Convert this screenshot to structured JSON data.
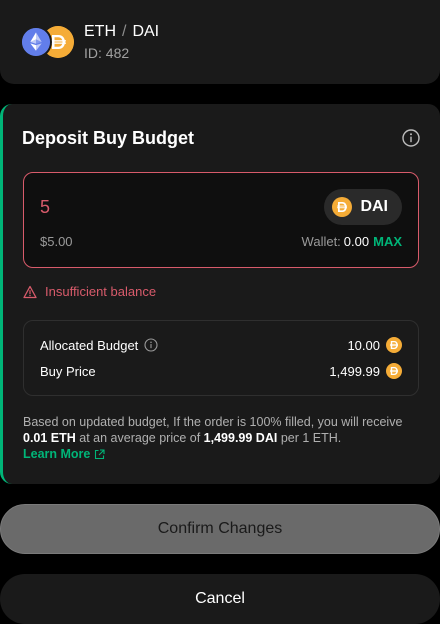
{
  "pair": {
    "base": "ETH",
    "separator": "/",
    "quote": "DAI",
    "id_text": "ID: 482"
  },
  "deposit": {
    "title": "Deposit Buy Budget",
    "amount": "5",
    "usd_value": "$5.00",
    "token": "DAI",
    "wallet_label": "Wallet:",
    "wallet_value": "0.00",
    "max_label": "MAX",
    "error": "Insufficient balance"
  },
  "summary": {
    "allocated_label": "Allocated Budget",
    "allocated_value": "10.00",
    "price_label": "Buy Price",
    "price_value": "1,499.99"
  },
  "footnote": {
    "part1": "Based on updated budget, If the order is 100% filled, you will receive ",
    "receive_amount": "0.01 ETH",
    "part2": " at an average price of ",
    "avg_price": "1,499.99 DAI",
    "part3": " per 1 ETH.",
    "learn_more": "Learn More"
  },
  "actions": {
    "confirm": "Confirm Changes",
    "cancel": "Cancel"
  },
  "colors": {
    "accent": "#00b578",
    "error": "#d85b6b",
    "eth": "#627eea",
    "dai": "#f5ac37"
  },
  "icons": [
    "eth-icon",
    "dai-icon",
    "info-icon",
    "warning-icon",
    "external-link-icon"
  ]
}
